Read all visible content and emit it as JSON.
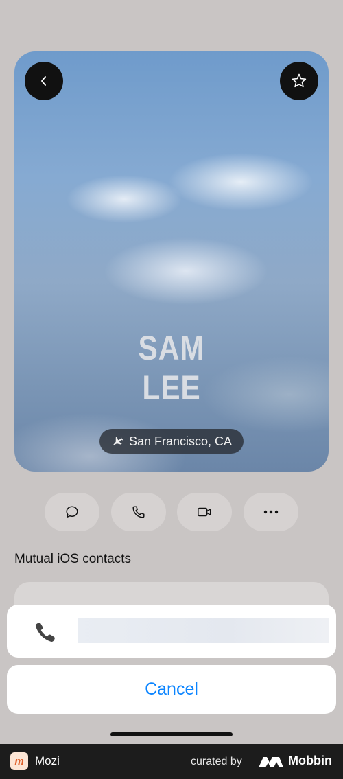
{
  "contact": {
    "first_name": "SAM",
    "last_name": "LEE",
    "location": "San Francisco, CA"
  },
  "icons": {
    "back": "chevron-left-icon",
    "favorite": "star-icon",
    "location": "airplane-icon",
    "message": "message-icon",
    "call": "phone-icon",
    "video": "video-icon",
    "more": "more-icon"
  },
  "sections": {
    "mutual_title": "Mutual iOS contacts"
  },
  "sheet": {
    "cancel_label": "Cancel"
  },
  "footer": {
    "app_name": "Mozi",
    "app_logo_letter": "m",
    "curated_by": "curated by",
    "brand": "Mobbin"
  },
  "colors": {
    "background": "#c9c5c4",
    "accent_blue": "#0a84ff",
    "footer_bg": "#1c1c1c",
    "app_logo_color": "#e0612b"
  }
}
